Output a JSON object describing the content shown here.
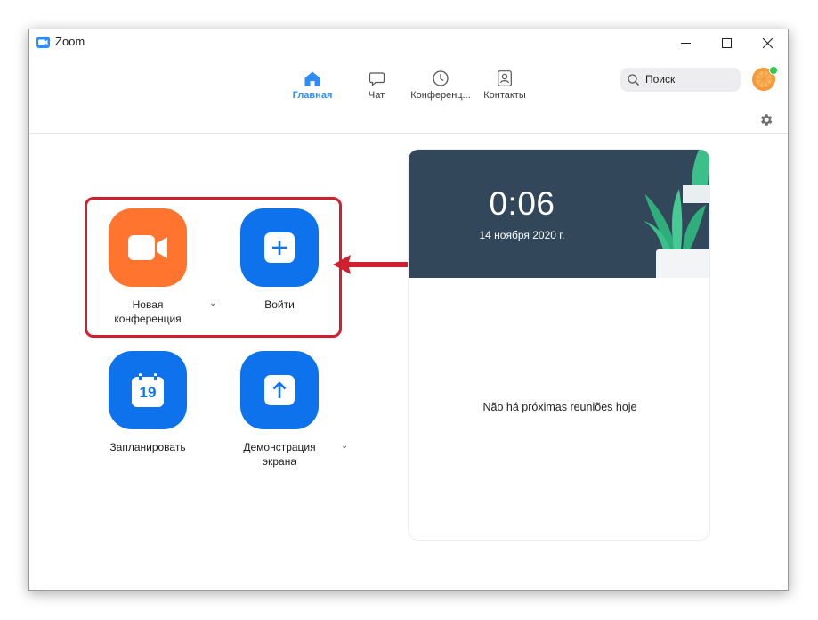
{
  "window": {
    "title": "Zoom",
    "controls": [
      "minimize-icon",
      "maximize-icon",
      "close-icon"
    ]
  },
  "nav": {
    "tabs": [
      {
        "label": "Главная",
        "icon": "home-icon",
        "active": true
      },
      {
        "label": "Чат",
        "icon": "chat-icon",
        "active": false
      },
      {
        "label": "Конференц...",
        "icon": "clock-icon",
        "active": false
      },
      {
        "label": "Контакты",
        "icon": "contacts-icon",
        "active": false
      }
    ],
    "search_placeholder": "Поиск",
    "presence": "online"
  },
  "actions": {
    "new_meeting": {
      "label": "Новая\nконференция",
      "icon": "video-camera-icon",
      "color": "#ff742e",
      "has_dropdown": true
    },
    "join": {
      "label": "Войти",
      "icon": "plus-icon",
      "color": "#0e72ed",
      "has_dropdown": false
    },
    "schedule": {
      "label": "Запланировать",
      "icon": "calendar-icon",
      "calendar_day": "19",
      "color": "#0e72ed",
      "has_dropdown": false
    },
    "share_screen": {
      "label": "Демонстрация\nэкрана",
      "icon": "share-up-arrow-icon",
      "color": "#0e72ed",
      "has_dropdown": true
    }
  },
  "annotation": {
    "highlight_color": "#d0202f",
    "arrow_color": "#d0202f"
  },
  "panel": {
    "time": "0:06",
    "date": "14 ноября 2020 г.",
    "empty_message": "Não há próximas reuniões hoje",
    "header_color": "#33475b"
  },
  "colors": {
    "accent": "#2d8cff",
    "orange": "#ff742e",
    "blue_tile": "#0e72ed"
  }
}
